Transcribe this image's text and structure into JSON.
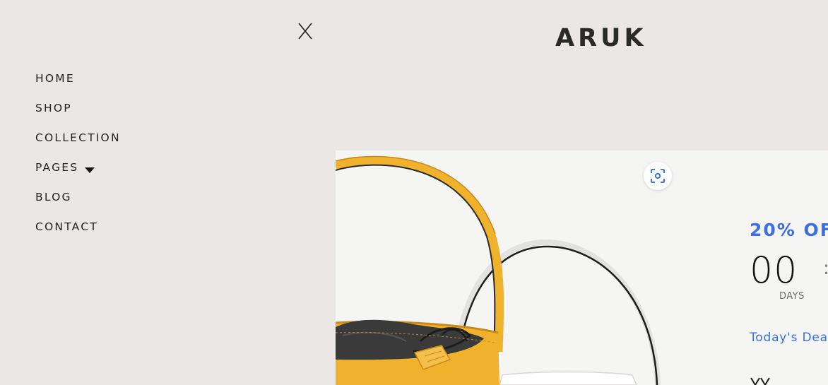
{
  "drawer": {
    "close_label": "X",
    "nav": [
      {
        "label": "HOME"
      },
      {
        "label": "SHOP"
      },
      {
        "label": "COLLECTION"
      },
      {
        "label": "PAGES",
        "has_dropdown": true
      },
      {
        "label": "BLOG"
      },
      {
        "label": "CONTACT"
      }
    ]
  },
  "header": {
    "logo": "ARUK"
  },
  "hero": {
    "offer": "20% OF",
    "countdown": {
      "days_value": "00",
      "days_label": "DAYS",
      "separator": ":"
    },
    "deal_link": "Today's Dea"
  },
  "colors": {
    "background": "#ebe7e6",
    "panel": "#f5f5f3",
    "accent": "#3b6fe3",
    "bag_yellow": "#f0b22d"
  }
}
